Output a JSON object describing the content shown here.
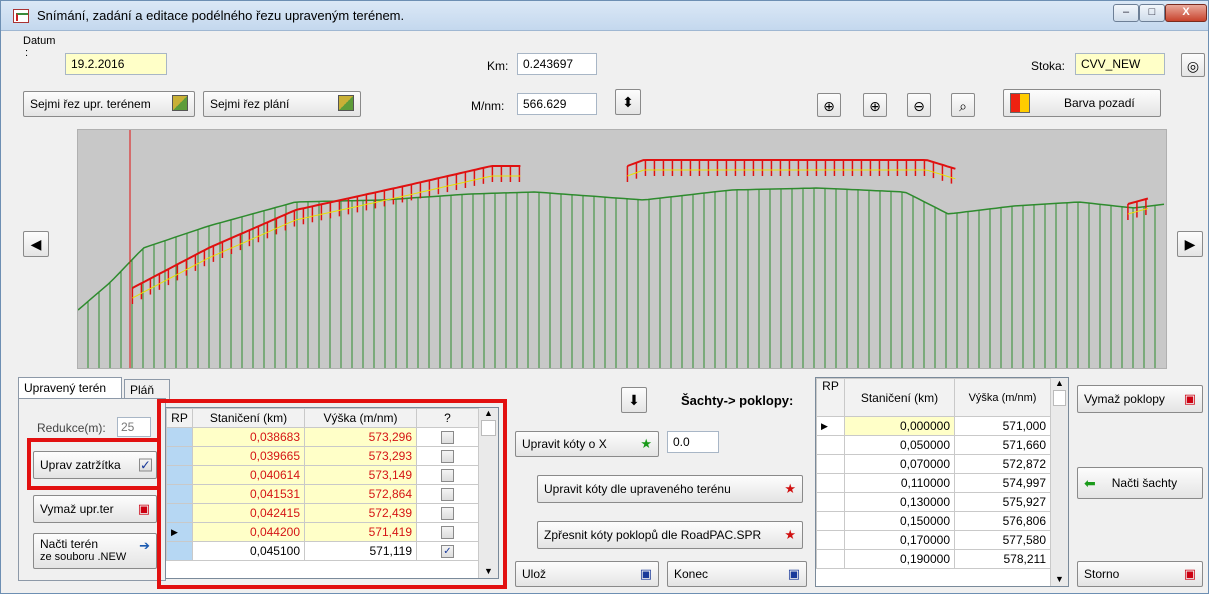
{
  "window": {
    "title": "Snímání, zadání a editace podélného řezu upraveným terénem.",
    "minimize": "–",
    "maximize": "□",
    "close": "X"
  },
  "header": {
    "datum_label": "Datum",
    "datum_colon": ":",
    "datum_value": "19.2.2016",
    "km_label": "Km:",
    "km_value": "0.243697",
    "stoka_label": "Stoka:",
    "stoka_value": "CVV_NEW",
    "mnm_label": "M/nm:",
    "mnm_value": "566.629",
    "sejmi_upr_label": "Sejmi řez  upr. terénem",
    "sejmi_plani_label": "Sejmi řez  plání",
    "barva_label": "Barva pozadí"
  },
  "colors": {
    "terrain_line": "#2e8b2e",
    "profile_line": "#e01010",
    "center_line": "#e8e000",
    "marker_line": "#e01010",
    "plot_bg": "#c8c8c8"
  },
  "tabs": {
    "upraveny": "Upravený terén",
    "plan": "Pláň"
  },
  "left_panel": {
    "redukce_label": "Redukce(m):",
    "redukce_value": "25",
    "uprav_zatrzitka": "Uprav zatržítka",
    "vymaz_upr_ter": "Vymaž upr.ter",
    "nacti_teren_line1": "Načti terén",
    "nacti_teren_line2": "ze souboru .NEW"
  },
  "grid1": {
    "headers": {
      "rp": "RP",
      "stan": "Staničení (km)",
      "vyska": "Výška (m/nm)",
      "q": "?"
    },
    "rows": [
      {
        "stan": "0,038683",
        "vyska": "573,296",
        "checked": false,
        "red": true,
        "pointer": false
      },
      {
        "stan": "0,039665",
        "vyska": "573,293",
        "checked": false,
        "red": true,
        "pointer": false
      },
      {
        "stan": "0,040614",
        "vyska": "573,149",
        "checked": false,
        "red": true,
        "pointer": false
      },
      {
        "stan": "0,041531",
        "vyska": "572,864",
        "checked": false,
        "red": true,
        "pointer": false
      },
      {
        "stan": "0,042415",
        "vyska": "572,439",
        "checked": false,
        "red": true,
        "pointer": false
      },
      {
        "stan": "0,044200",
        "vyska": "571,419",
        "checked": false,
        "red": true,
        "pointer": true
      },
      {
        "stan": "0,045100",
        "vyska": "571,119",
        "checked": true,
        "red": false,
        "pointer": false
      }
    ]
  },
  "middle": {
    "sachty_poklopy": "Šachty-> poklopy:",
    "upravit_koty_x": "Upravit kóty  o X",
    "x_value": "0.0",
    "upravit_koty_terenu": "Upravit kóty  dle upraveného terénu",
    "zpresnit_koty": "Zpřesnit kóty poklopů dle RoadPAC.SPR",
    "uloz": "Ulož",
    "konec": "Konec"
  },
  "grid2": {
    "headers": {
      "rp": "RP",
      "stan": "Staničení (km)",
      "vyska": "Výška (m/nm)"
    },
    "rows": [
      {
        "stan": "0,000000",
        "vyska": "571,000"
      },
      {
        "stan": "0,050000",
        "vyska": "571,660"
      },
      {
        "stan": "0,070000",
        "vyska": "572,872"
      },
      {
        "stan": "0,110000",
        "vyska": "574,997"
      },
      {
        "stan": "0,130000",
        "vyska": "575,927"
      },
      {
        "stan": "0,150000",
        "vyska": "576,806"
      },
      {
        "stan": "0,170000",
        "vyska": "577,580"
      },
      {
        "stan": "0,190000",
        "vyska": "578,211"
      }
    ]
  },
  "right_panel": {
    "vymaz_poklopy": "Vymaž poklopy",
    "nacti_sachty": "Načti šachty",
    "storno": "Storno"
  }
}
